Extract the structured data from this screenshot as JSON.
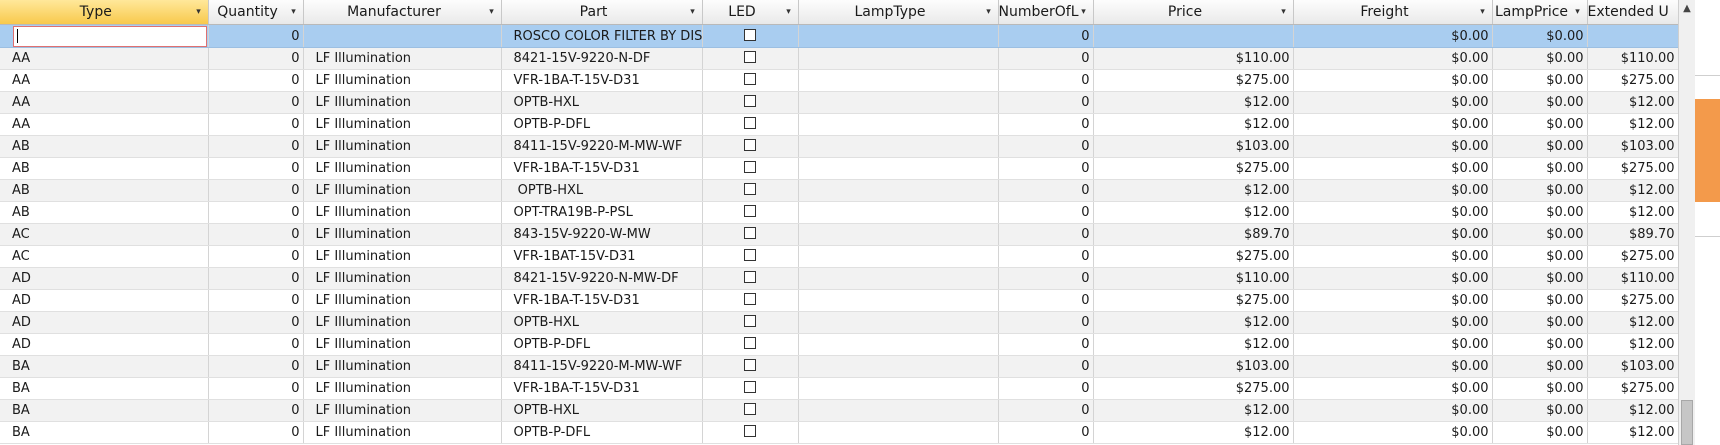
{
  "columns": [
    {
      "key": "type",
      "label": "Type"
    },
    {
      "key": "quantity",
      "label": "Quantity"
    },
    {
      "key": "manufacturer",
      "label": "Manufacturer"
    },
    {
      "key": "part",
      "label": "Part"
    },
    {
      "key": "led",
      "label": "LED"
    },
    {
      "key": "lamptype",
      "label": "LampType"
    },
    {
      "key": "numberof",
      "label": "NumberOfL"
    },
    {
      "key": "price",
      "label": "Price"
    },
    {
      "key": "freight",
      "label": "Freight"
    },
    {
      "key": "lampprice",
      "label": "LampPrice"
    },
    {
      "key": "extended",
      "label": "Extended U"
    }
  ],
  "rows": [
    {
      "type": "",
      "quantity": "0",
      "manufacturer": "",
      "part": "ROSCO COLOR FILTER BY DIS",
      "lamptype": "",
      "numberof": "0",
      "price": "",
      "freight": "$0.00",
      "lampprice": "$0.00",
      "extended": ""
    },
    {
      "type": "AA",
      "quantity": "0",
      "manufacturer": "LF Illumination",
      "part": "8421-15V-9220-N-DF",
      "lamptype": "",
      "numberof": "0",
      "price": "$110.00",
      "freight": "$0.00",
      "lampprice": "$0.00",
      "extended": "$110.00"
    },
    {
      "type": "AA",
      "quantity": "0",
      "manufacturer": "LF Illumination",
      "part": "VFR-1BA-T-15V-D31",
      "lamptype": "",
      "numberof": "0",
      "price": "$275.00",
      "freight": "$0.00",
      "lampprice": "$0.00",
      "extended": "$275.00"
    },
    {
      "type": "AA",
      "quantity": "0",
      "manufacturer": "LF Illumination",
      "part": "OPTB-HXL",
      "lamptype": "",
      "numberof": "0",
      "price": "$12.00",
      "freight": "$0.00",
      "lampprice": "$0.00",
      "extended": "$12.00"
    },
    {
      "type": "AA",
      "quantity": "0",
      "manufacturer": "LF Illumination",
      "part": "OPTB-P-DFL",
      "lamptype": "",
      "numberof": "0",
      "price": "$12.00",
      "freight": "$0.00",
      "lampprice": "$0.00",
      "extended": "$12.00"
    },
    {
      "type": "AB",
      "quantity": "0",
      "manufacturer": "LF Illumination",
      "part": "8411-15V-9220-M-MW-WF",
      "lamptype": "",
      "numberof": "0",
      "price": "$103.00",
      "freight": "$0.00",
      "lampprice": "$0.00",
      "extended": "$103.00"
    },
    {
      "type": "AB",
      "quantity": "0",
      "manufacturer": "LF Illumination",
      "part": "VFR-1BA-T-15V-D31",
      "lamptype": "",
      "numberof": "0",
      "price": "$275.00",
      "freight": "$0.00",
      "lampprice": "$0.00",
      "extended": "$275.00"
    },
    {
      "type": "AB",
      "quantity": "0",
      "manufacturer": "LF Illumination",
      "part": " OPTB-HXL",
      "lamptype": "",
      "numberof": "0",
      "price": "$12.00",
      "freight": "$0.00",
      "lampprice": "$0.00",
      "extended": "$12.00"
    },
    {
      "type": "AB",
      "quantity": "0",
      "manufacturer": "LF Illumination",
      "part": "OPT-TRA19B-P-PSL",
      "lamptype": "",
      "numberof": "0",
      "price": "$12.00",
      "freight": "$0.00",
      "lampprice": "$0.00",
      "extended": "$12.00"
    },
    {
      "type": "AC",
      "quantity": "0",
      "manufacturer": "LF Illumination",
      "part": "843-15V-9220-W-MW",
      "lamptype": "",
      "numberof": "0",
      "price": "$89.70",
      "freight": "$0.00",
      "lampprice": "$0.00",
      "extended": "$89.70"
    },
    {
      "type": "AC",
      "quantity": "0",
      "manufacturer": "LF Illumination",
      "part": "VFR-1BAT-15V-D31",
      "lamptype": "",
      "numberof": "0",
      "price": "$275.00",
      "freight": "$0.00",
      "lampprice": "$0.00",
      "extended": "$275.00"
    },
    {
      "type": "AD",
      "quantity": "0",
      "manufacturer": "LF Illumination",
      "part": "8421-15V-9220-N-MW-DF",
      "lamptype": "",
      "numberof": "0",
      "price": "$110.00",
      "freight": "$0.00",
      "lampprice": "$0.00",
      "extended": "$110.00"
    },
    {
      "type": "AD",
      "quantity": "0",
      "manufacturer": "LF Illumination",
      "part": "VFR-1BA-T-15V-D31",
      "lamptype": "",
      "numberof": "0",
      "price": "$275.00",
      "freight": "$0.00",
      "lampprice": "$0.00",
      "extended": "$275.00"
    },
    {
      "type": "AD",
      "quantity": "0",
      "manufacturer": "LF Illumination",
      "part": "OPTB-HXL",
      "lamptype": "",
      "numberof": "0",
      "price": "$12.00",
      "freight": "$0.00",
      "lampprice": "$0.00",
      "extended": "$12.00"
    },
    {
      "type": "AD",
      "quantity": "0",
      "manufacturer": "LF Illumination",
      "part": "OPTB-P-DFL",
      "lamptype": "",
      "numberof": "0",
      "price": "$12.00",
      "freight": "$0.00",
      "lampprice": "$0.00",
      "extended": "$12.00"
    },
    {
      "type": "BA",
      "quantity": "0",
      "manufacturer": "LF Illumination",
      "part": "8411-15V-9220-M-MW-WF",
      "lamptype": "",
      "numberof": "0",
      "price": "$103.00",
      "freight": "$0.00",
      "lampprice": "$0.00",
      "extended": "$103.00"
    },
    {
      "type": "BA",
      "quantity": "0",
      "manufacturer": "LF Illumination",
      "part": "VFR-1BA-T-15V-D31",
      "lamptype": "",
      "numberof": "0",
      "price": "$275.00",
      "freight": "$0.00",
      "lampprice": "$0.00",
      "extended": "$275.00"
    },
    {
      "type": "BA",
      "quantity": "0",
      "manufacturer": "LF Illumination",
      "part": "OPTB-HXL",
      "lamptype": "",
      "numberof": "0",
      "price": "$12.00",
      "freight": "$0.00",
      "lampprice": "$0.00",
      "extended": "$12.00"
    },
    {
      "type": "BA",
      "quantity": "0",
      "manufacturer": "LF Illumination",
      "part": "OPTB-P-DFL",
      "lamptype": "",
      "numberof": "0",
      "price": "$12.00",
      "freight": "$0.00",
      "lampprice": "$0.00",
      "extended": "$12.00"
    }
  ],
  "icons": {
    "sort": "chevron-down-icon",
    "scroll_up": "scroll-up-arrow-icon",
    "checkbox": "checkbox-icon"
  },
  "colors": {
    "active_header": "#f8c94c",
    "selected_row": "#a9cdf0",
    "edit_border": "#e07070",
    "side_accent": "#f39a4b"
  }
}
